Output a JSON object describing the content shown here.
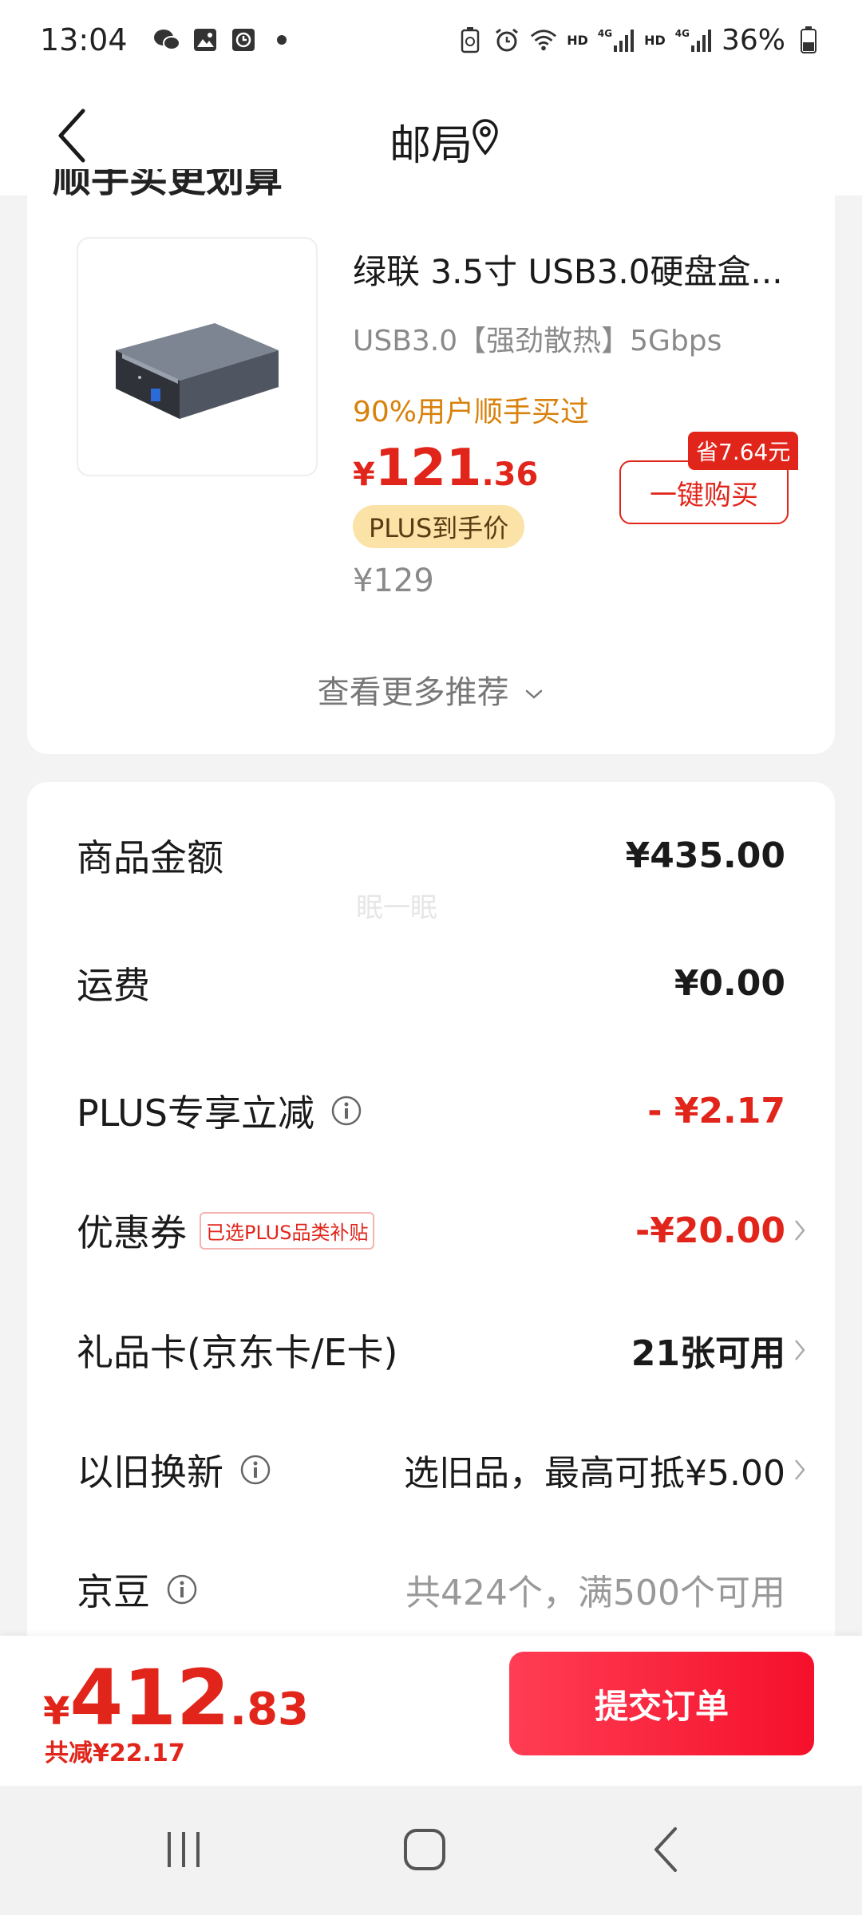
{
  "status_bar": {
    "time": "13:04",
    "battery": "36%",
    "hd_1": "HD",
    "hd_2": "HD",
    "net_1": "4G",
    "net_2": "4G"
  },
  "header": {
    "title": "邮局"
  },
  "recommend": {
    "section_heading": "顺手买更划算",
    "product": {
      "name": "绿联 3.5寸 USB3.0硬盘盒...",
      "spec": "USB3.0【强劲散热】5Gbps",
      "buyers": "90%用户顺手买过",
      "price_symbol": "¥",
      "price_int": "121",
      "price_dec": ".36",
      "plus_label": "PLUS到手价",
      "original_price": "¥129",
      "save_tag": "省7.64元",
      "buy_label": "一键购买"
    },
    "see_more": "查看更多推荐"
  },
  "summary": {
    "watermark": "眠一眠",
    "goods_amount": {
      "label": "商品金额",
      "value": "¥435.00"
    },
    "shipping": {
      "label": "运费",
      "value": "¥0.00"
    },
    "plus_discount": {
      "label": "PLUS专享立减",
      "value": "- ¥2.17"
    },
    "coupon": {
      "label": "优惠券",
      "tag": "已选PLUS品类补贴",
      "value": "-¥20.00"
    },
    "gift_card": {
      "label": "礼品卡(京东卡/E卡)",
      "value": "21张可用"
    },
    "trade_in": {
      "label": "以旧换新",
      "value": "选旧品，最高可抵¥5.00"
    },
    "jd_beans": {
      "label": "京豆",
      "value": "共424个，满500个可用"
    }
  },
  "footer": {
    "total_symbol": "¥",
    "total_int": "412",
    "total_dec": ".83",
    "saved": "共减¥22.17",
    "submit_label": "提交订单"
  },
  "colors": {
    "accent": "#e1251b",
    "plus_pill": "#fbe3a7",
    "buyers_text": "#d8810b"
  }
}
